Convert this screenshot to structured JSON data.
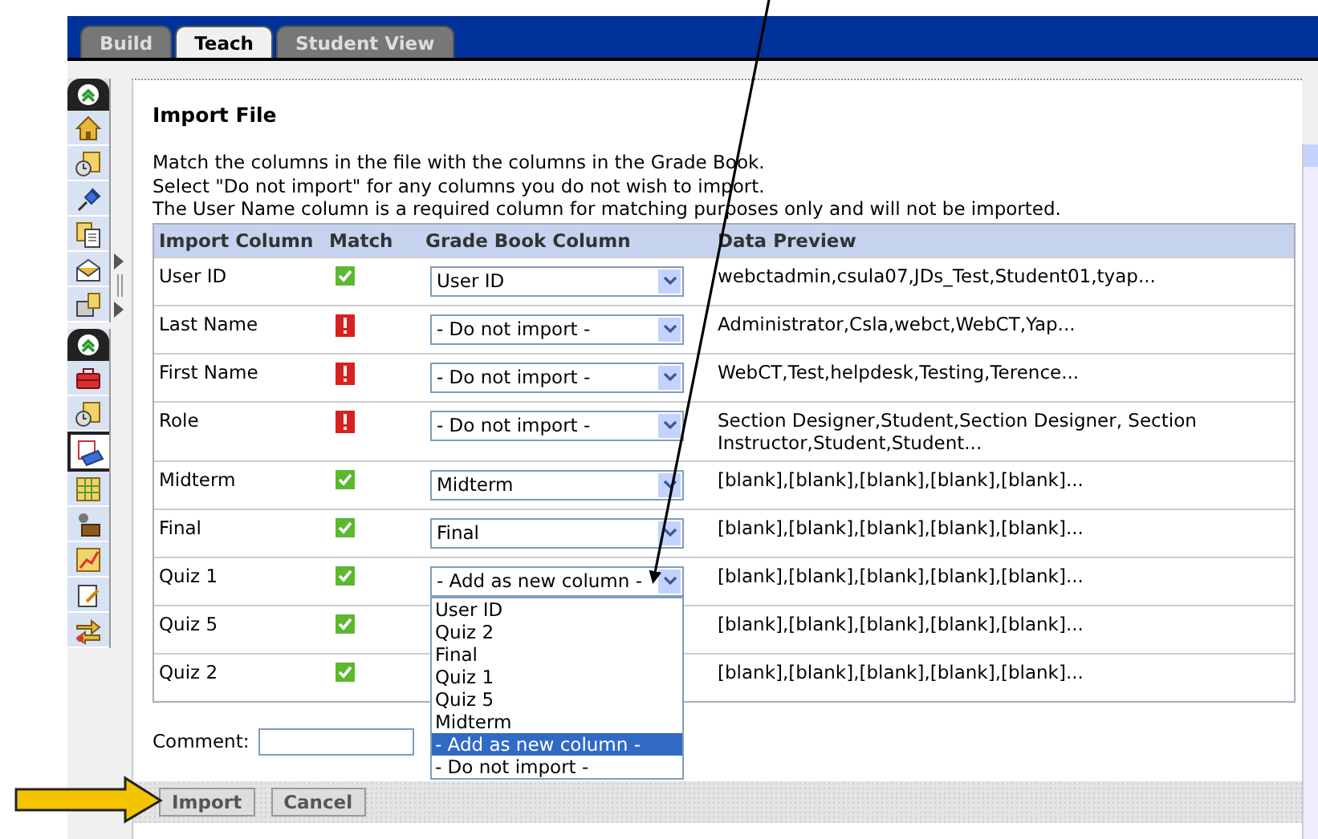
{
  "tabs": [
    {
      "label": "Build",
      "selected": false
    },
    {
      "label": "Teach",
      "selected": true
    },
    {
      "label": "Student View",
      "selected": false
    }
  ],
  "toolbar": {
    "sections": [
      {
        "items": [
          {
            "selected": false
          },
          {
            "selected": false
          },
          {
            "selected": false
          },
          {
            "selected": false
          },
          {
            "selected": false
          },
          {
            "selected": false
          }
        ]
      },
      {
        "items": [
          {
            "selected": false
          },
          {
            "selected": false
          },
          {
            "selected": true
          },
          {
            "selected": false
          },
          {
            "selected": false
          },
          {
            "selected": false
          },
          {
            "selected": false
          },
          {
            "selected": false
          }
        ]
      }
    ]
  },
  "page": {
    "title": "Import File",
    "instructions": [
      "Match the columns in the file with the columns in the Grade Book.",
      "Select \"Do not import\" for any columns you do not wish to import.",
      "The User Name column is a required column for matching purposes only and will not be imported."
    ]
  },
  "table": {
    "columns": [
      "Import Column",
      "Match",
      "Grade Book Column",
      "Data Preview"
    ],
    "rows": [
      {
        "import_column": "User ID",
        "matched": true,
        "grade_book_column": "User ID",
        "data_preview": "webctadmin,csula07,JDs_Test,Student01,tyap..."
      },
      {
        "import_column": "Last Name",
        "matched": false,
        "grade_book_column": "- Do not import -",
        "data_preview": "Administrator,Csla,webct,WebCT,Yap..."
      },
      {
        "import_column": "First Name",
        "matched": false,
        "grade_book_column": "- Do not import -",
        "data_preview": "WebCT,Test,helpdesk,Testing,Terence..."
      },
      {
        "import_column": "Role",
        "matched": false,
        "grade_book_column": "- Do not import -",
        "data_preview": "Section Designer,Student,Section Designer, Section Instructor,Student,Student..."
      },
      {
        "import_column": "Midterm",
        "matched": true,
        "grade_book_column": "Midterm",
        "data_preview": "[blank],[blank],[blank],[blank],[blank]..."
      },
      {
        "import_column": "Final",
        "matched": true,
        "grade_book_column": "Final",
        "data_preview": "[blank],[blank],[blank],[blank],[blank]..."
      },
      {
        "import_column": "Quiz 1",
        "matched": true,
        "grade_book_column": "- Add as new column -",
        "data_preview": "[blank],[blank],[blank],[blank],[blank]...",
        "open_options": [
          {
            "label": "User ID",
            "selected": false
          },
          {
            "label": "Quiz 2",
            "selected": false
          },
          {
            "label": "Final",
            "selected": false
          },
          {
            "label": "Quiz 1",
            "selected": false
          },
          {
            "label": "Quiz 5",
            "selected": false
          },
          {
            "label": "Midterm",
            "selected": false
          },
          {
            "label": "- Add as new column -",
            "selected": true
          },
          {
            "label": "- Do not import -",
            "selected": false
          }
        ]
      },
      {
        "import_column": "Quiz 5",
        "matched": true,
        "data_preview": "[blank],[blank],[blank],[blank],[blank]..."
      },
      {
        "import_column": "Quiz 2",
        "matched": true,
        "data_preview": "[blank],[blank],[blank],[blank],[blank]..."
      }
    ]
  },
  "comment": {
    "label": "Comment:"
  },
  "buttons": [
    "Import",
    "Cancel"
  ]
}
